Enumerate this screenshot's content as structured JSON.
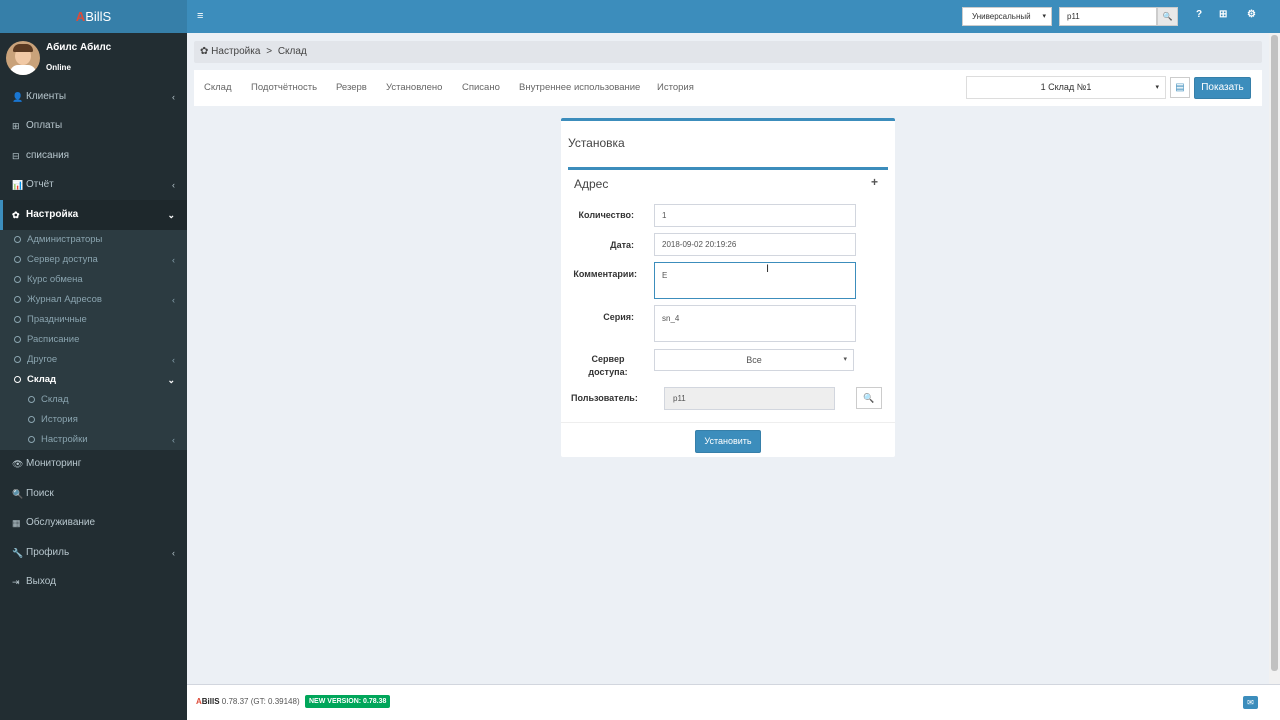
{
  "app": {
    "logo_a": "A",
    "logo_rest": "BillS"
  },
  "user": {
    "name": "Абилс Абилс",
    "status": "Online"
  },
  "menu": [
    {
      "label": "Клиенты",
      "icon": "user-icon",
      "glyph": "👤",
      "chev": "‹"
    },
    {
      "label": "Оплаты",
      "icon": "plus-square-icon",
      "glyph": "⊞",
      "chev": ""
    },
    {
      "label": "списания",
      "icon": "minus-square-icon",
      "glyph": "⊟",
      "chev": ""
    },
    {
      "label": "Отчёт",
      "icon": "bar-chart-icon",
      "glyph": "📊",
      "chev": "‹"
    },
    {
      "label": "Настройка",
      "icon": "gear-icon",
      "glyph": "✿",
      "chev": "⌄"
    }
  ],
  "submenu": [
    {
      "label": "Администраторы",
      "chev": ""
    },
    {
      "label": "Сервер доступа",
      "chev": "‹"
    },
    {
      "label": "Курс обмена",
      "chev": ""
    },
    {
      "label": "Журнал Адресов",
      "chev": "‹"
    },
    {
      "label": "Праздничные",
      "chev": ""
    },
    {
      "label": "Расписание",
      "chev": ""
    },
    {
      "label": "Другое",
      "chev": "‹"
    },
    {
      "label": "Склад",
      "chev": "⌄"
    },
    {
      "label": "Склад",
      "chev": ""
    },
    {
      "label": "История",
      "chev": ""
    },
    {
      "label": "Настройки",
      "chev": "‹"
    }
  ],
  "menu2": [
    {
      "label": "Мониторинг",
      "icon": "eye-icon",
      "glyph": "👁",
      "chev": ""
    },
    {
      "label": "Поиск",
      "icon": "search-icon",
      "glyph": "🔍",
      "chev": ""
    },
    {
      "label": "Обслуживание",
      "icon": "film-icon",
      "glyph": "▦",
      "chev": ""
    },
    {
      "label": "Профиль",
      "icon": "wrench-icon",
      "glyph": "🔧",
      "chev": "‹"
    },
    {
      "label": "Выход",
      "icon": "sign-out-icon",
      "glyph": "⇥",
      "chev": ""
    }
  ],
  "topbar": {
    "menu_glyph": "≡",
    "search_type": "Универсальный",
    "search_value": "p11",
    "search_glyph": "🔍",
    "help_glyph": "?",
    "apps_glyph": "⊞",
    "settings_glyph": "⚙",
    "caret": "▾"
  },
  "breadcrumb": {
    "root": "Настройка",
    "sep": ">",
    "current": "Склад",
    "gear": "✿"
  },
  "tabs": [
    "Склад",
    "Подотчётность",
    "Резерв",
    "Установлено",
    "Списано",
    "Внутреннее использование",
    "История"
  ],
  "warehouse": {
    "selected": "1 Склад №1",
    "calc_glyph": "▤",
    "show_label": "Показать"
  },
  "form": {
    "title": "Установка",
    "section": "Адрес",
    "plus": "+",
    "qty_label": "Количество:",
    "qty_value": "1",
    "date_label": "Дата:",
    "date_value": "2018-09-02 20:19:26",
    "comment_label": "Комментарии:",
    "comment_value": "Е",
    "series_label": "Серия:",
    "series_value": "sn_4",
    "server_label": "Сервер доступа:",
    "server_value": "Все",
    "user_label": "Пользователь:",
    "user_value": "p11",
    "search_glyph": "🔍",
    "install_label": "Установить"
  },
  "footer": {
    "logo_a": "A",
    "logo_rest": "BillS",
    "version": " 0.78.37 (GT: 0.39148)",
    "new_version": "NEW VERSION: 0.78.38",
    "chat_glyph": "✉"
  }
}
